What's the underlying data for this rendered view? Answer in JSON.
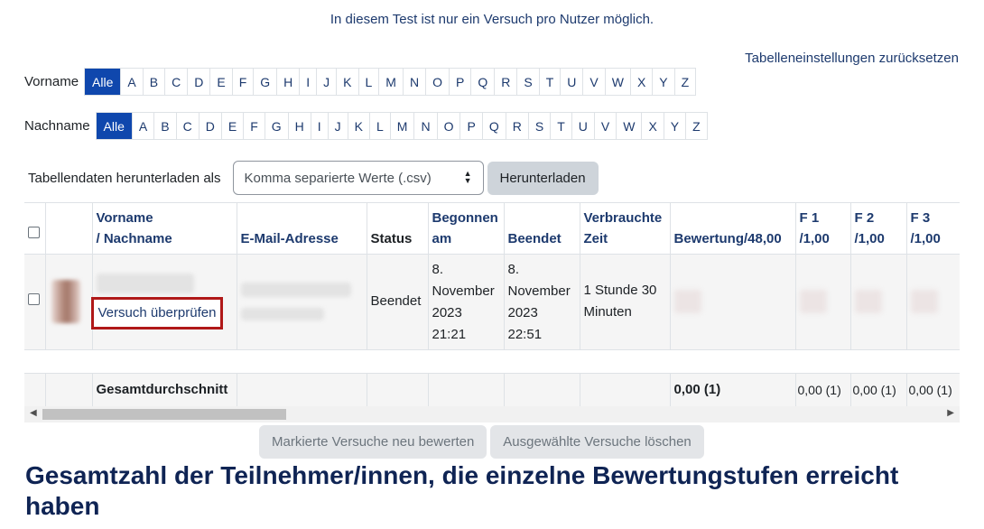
{
  "notice": "In diesem Test ist nur ein Versuch pro Nutzer möglich.",
  "reset_link": "Tabelleneinstellungen zurücksetzen",
  "firstname_filter": {
    "label": "Vorname",
    "all": "Alle",
    "letters": [
      "A",
      "B",
      "C",
      "D",
      "E",
      "F",
      "G",
      "H",
      "I",
      "J",
      "K",
      "L",
      "M",
      "N",
      "O",
      "P",
      "Q",
      "R",
      "S",
      "T",
      "U",
      "V",
      "W",
      "X",
      "Y",
      "Z"
    ]
  },
  "lastname_filter": {
    "label": "Nachname",
    "all": "Alle",
    "letters": [
      "A",
      "B",
      "C",
      "D",
      "E",
      "F",
      "G",
      "H",
      "I",
      "J",
      "K",
      "L",
      "M",
      "N",
      "O",
      "P",
      "Q",
      "R",
      "S",
      "T",
      "U",
      "V",
      "W",
      "X",
      "Y",
      "Z"
    ]
  },
  "download": {
    "label": "Tabellendaten herunterladen als",
    "format": "Komma separierte Werte (.csv)",
    "button": "Herunterladen"
  },
  "table": {
    "headers": {
      "name_line1": "Vorname",
      "name_line2": "/ Nachname",
      "email": "E-Mail-Adresse",
      "status": "Status",
      "started_line1": "Begonnen",
      "started_line2": "am",
      "finished": "Beendet",
      "time_line1": "Verbrauchte",
      "time_line2": "Zeit",
      "grade": "Bewertung/48,00",
      "q1_line1": "F 1",
      "q1_line2": "/1,00",
      "q2_line1": "F 2",
      "q2_line2": "/1,00",
      "q3_line1": "F 3",
      "q3_line2": "/1,00"
    },
    "row": {
      "review_link": "Versuch überprüfen",
      "status": "Beendet",
      "started": [
        "8.",
        "November",
        "2023",
        "21:21"
      ],
      "finished": [
        "8.",
        "November",
        "2023",
        "22:51"
      ],
      "time": [
        "1 Stunde 30",
        "Minuten"
      ]
    },
    "average": {
      "label": "Gesamtdurchschnitt",
      "grade": "0,00 (1)",
      "q1": "0,00 (1)",
      "q2": "0,00 (1)",
      "q3": "0,00 (1)"
    }
  },
  "actions": {
    "regrade": "Markierte Versuche neu bewerten",
    "delete": "Ausgewählte Versuche löschen"
  },
  "heading": "Gesamtzahl der Teilnehmer/innen, die einzelne Bewertungstufen erreicht haben"
}
